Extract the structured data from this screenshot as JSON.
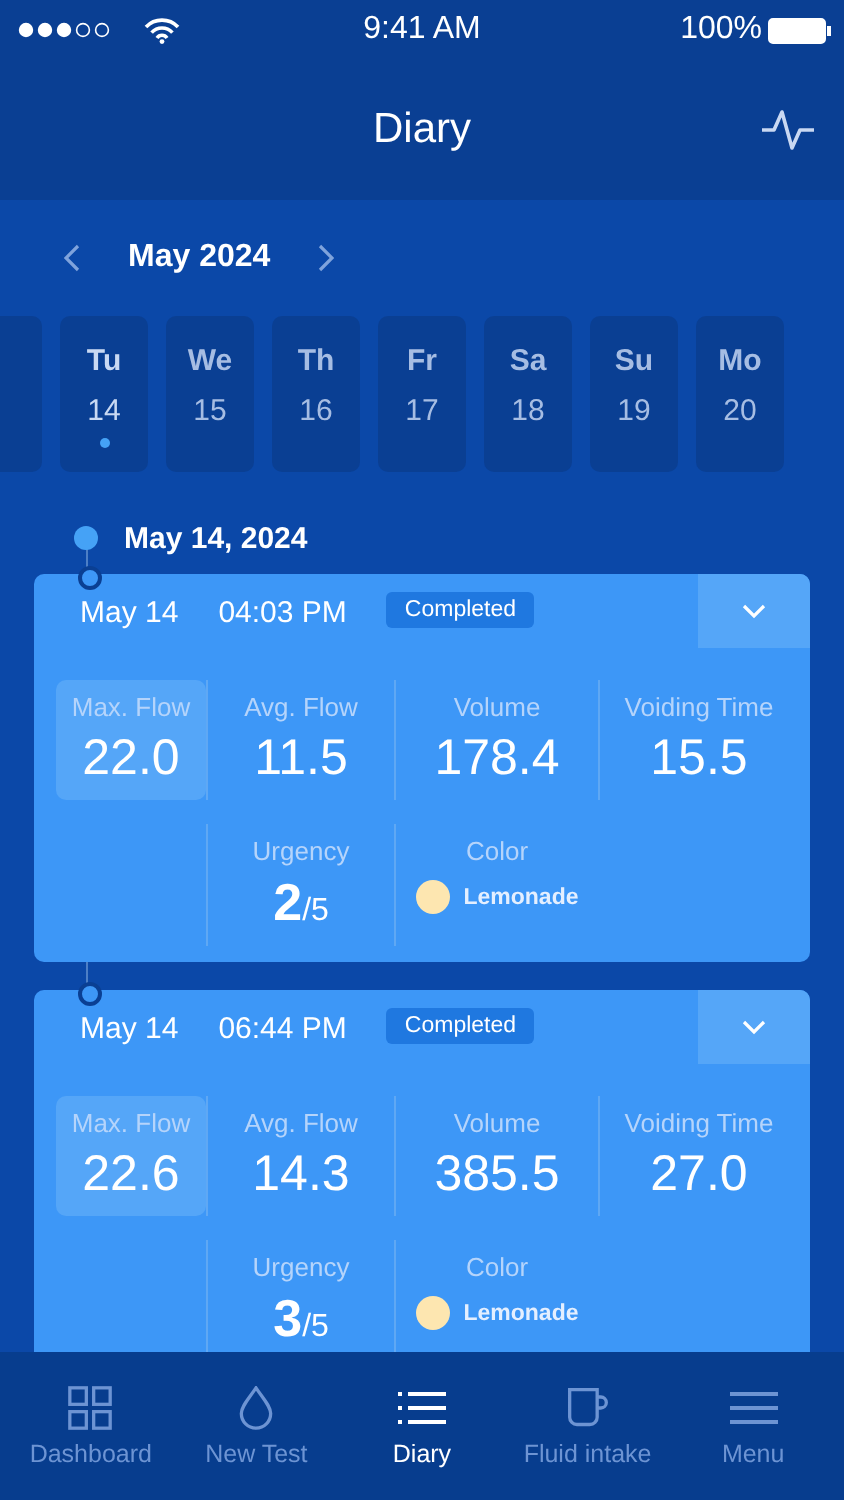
{
  "status_bar": {
    "time": "9:41 AM",
    "battery": "100%"
  },
  "header": {
    "title": "Diary"
  },
  "month": {
    "label": "May 2024"
  },
  "days": [
    {
      "name": "Tu",
      "date": "14",
      "selected": true
    },
    {
      "name": "We",
      "date": "15",
      "selected": false
    },
    {
      "name": "Th",
      "date": "16",
      "selected": false
    },
    {
      "name": "Fr",
      "date": "17",
      "selected": false
    },
    {
      "name": "Sa",
      "date": "18",
      "selected": false
    },
    {
      "name": "Su",
      "date": "19",
      "selected": false
    },
    {
      "name": "Mo",
      "date": "20",
      "selected": false
    }
  ],
  "date_heading": "May 14, 2024",
  "entries": [
    {
      "date": "May 14",
      "time": "04:03 PM",
      "status": "Completed",
      "metrics": [
        {
          "label": "Max. Flow",
          "value": "22.0",
          "selected": true
        },
        {
          "label": "Avg. Flow",
          "value": "11.5",
          "selected": false
        },
        {
          "label": "Volume",
          "value": "178.4",
          "selected": false
        },
        {
          "label": "Voiding Time",
          "value": "15.5",
          "selected": false
        }
      ],
      "urgency_label": "Urgency",
      "urgency": "2",
      "urgency_max": "/5",
      "color_label": "Color",
      "color_name": "Lemonade",
      "color": "#fde6b0"
    },
    {
      "date": "May 14",
      "time": "06:44 PM",
      "status": "Completed",
      "metrics": [
        {
          "label": "Max. Flow",
          "value": "22.6",
          "selected": true
        },
        {
          "label": "Avg. Flow",
          "value": "14.3",
          "selected": false
        },
        {
          "label": "Volume",
          "value": "385.5",
          "selected": false
        },
        {
          "label": "Voiding Time",
          "value": "27.0",
          "selected": false
        }
      ],
      "urgency_label": "Urgency",
      "urgency": "3",
      "urgency_max": "/5",
      "color_label": "Color",
      "color_name": "Lemonade",
      "color": "#fde6b0"
    }
  ],
  "tabs": [
    {
      "label": "Dashboard",
      "kind": "grid",
      "selected": false
    },
    {
      "label": "New Test",
      "kind": "drop",
      "selected": false
    },
    {
      "label": "Diary",
      "kind": "list",
      "selected": true
    },
    {
      "label": "Fluid intake",
      "kind": "cup",
      "selected": false
    },
    {
      "label": "Menu",
      "kind": "menu",
      "selected": false
    }
  ]
}
